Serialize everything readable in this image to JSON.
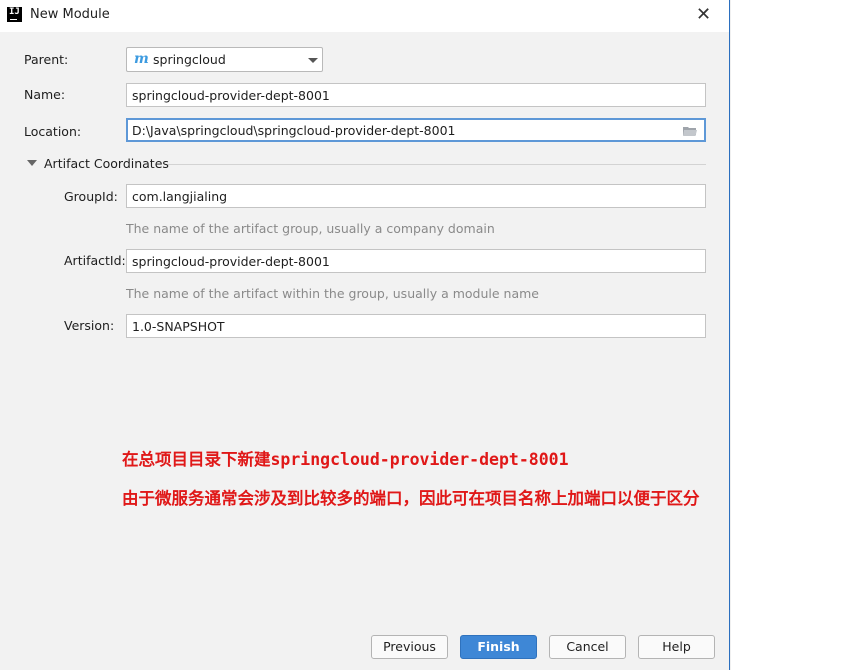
{
  "window": {
    "title": "New Module",
    "app_icon_text": "IJ"
  },
  "form": {
    "parent": {
      "label": "Parent:",
      "value": "springcloud"
    },
    "name": {
      "label": "Name:",
      "value": "springcloud-provider-dept-8001"
    },
    "location": {
      "label": "Location:",
      "value": "D:\\Java\\springcloud\\springcloud-provider-dept-8001"
    }
  },
  "artifact": {
    "section_title": "Artifact Coordinates",
    "group_id": {
      "label": "GroupId:",
      "value": "com.langjialing",
      "hint": "The name of the artifact group, usually a company domain"
    },
    "artifact_id": {
      "label": "ArtifactId:",
      "value": "springcloud-provider-dept-8001",
      "hint": "The name of the artifact within the group, usually a module name"
    },
    "version": {
      "label": "Version:",
      "value": "1.0-SNAPSHOT"
    }
  },
  "annotation": {
    "line1": "在总项目目录下新建springcloud-provider-dept-8001",
    "line2": "由于微服务通常会涉及到比较多的端口，因此可在项目名称上加端口以便于区分",
    "color": "#e01818"
  },
  "buttons": {
    "previous": "Previous",
    "finish": "Finish",
    "cancel": "Cancel",
    "help": "Help"
  },
  "colors": {
    "accent": "#3e87d6",
    "focus_border": "#5e98d7",
    "maven_icon": "#3d9be0"
  },
  "icons": {
    "app": "intellij-icon",
    "close": "close-icon",
    "parent": "maven-icon",
    "dropdown": "chevron-down-icon",
    "browse": "folder-icon",
    "section": "expand-triangle-icon"
  }
}
